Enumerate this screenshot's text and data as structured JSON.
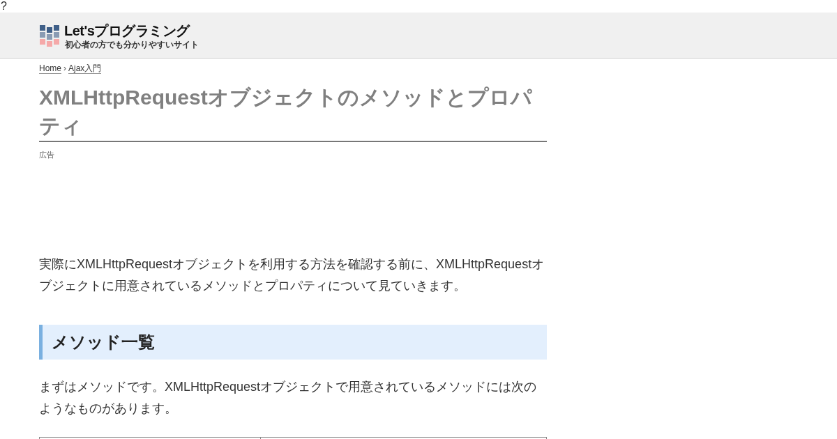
{
  "stray_text": "?",
  "header": {
    "logo": {
      "title": "Let'sプログラミング",
      "tagline": "初心者の方でも分かりやすいサイト"
    }
  },
  "breadcrumb": {
    "items": [
      {
        "label": "Home"
      },
      {
        "label": "Ajax入門"
      }
    ],
    "separator": "›"
  },
  "article": {
    "title": "XMLHttpRequestオブジェクトのメソッドとプロパティ",
    "ad_label": "広告",
    "blocks": [
      {
        "kind": "paragraph",
        "text": "実際にXMLHttpRequestオブジェクトを利用する方法を確認する前に、XMLHttpRequestオブジェクトに用意されているメソッドとプロパティについて見ていきます。"
      },
      {
        "kind": "heading",
        "text": "メソッド一覧"
      },
      {
        "kind": "paragraph",
        "text": "まずはメソッドです。XMLHttpRequestオブジェクトで用意されているメソッドには次のようなものがあります。"
      },
      {
        "kind": "table"
      }
    ]
  }
}
